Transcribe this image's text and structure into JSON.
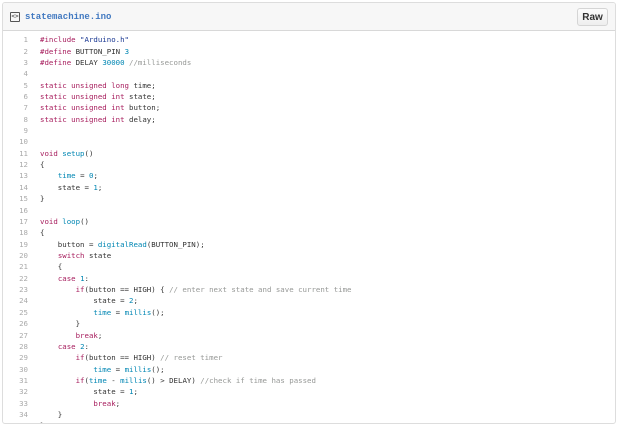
{
  "file": {
    "name": "statemachine.ino",
    "icon": "code-file-icon",
    "raw_label": "Raw"
  },
  "code_lines": [
    [
      [
        "pre",
        "#include "
      ],
      [
        "str",
        "\"Arduino.h\""
      ]
    ],
    [
      [
        "pre",
        "#define "
      ],
      [
        "id",
        "BUTTON_PIN "
      ],
      [
        "nm",
        "3"
      ]
    ],
    [
      [
        "pre",
        "#define "
      ],
      [
        "id",
        "DELAY "
      ],
      [
        "nm",
        "30000"
      ],
      [
        "cm",
        " //milliseconds"
      ]
    ],
    [],
    [
      [
        "kw",
        "static unsigned long "
      ],
      [
        "id",
        "time;"
      ]
    ],
    [
      [
        "kw",
        "static unsigned int "
      ],
      [
        "id",
        "state;"
      ]
    ],
    [
      [
        "kw",
        "static unsigned int "
      ],
      [
        "id",
        "button;"
      ]
    ],
    [
      [
        "kw",
        "static unsigned int "
      ],
      [
        "id",
        "delay;"
      ]
    ],
    [],
    [],
    [
      [
        "kw",
        "void "
      ],
      [
        "nm",
        "setup"
      ],
      [
        "id",
        "()"
      ]
    ],
    [
      [
        "id",
        "{"
      ]
    ],
    [
      [
        "id",
        "    "
      ],
      [
        "nm",
        "time"
      ],
      [
        "id",
        " = "
      ],
      [
        "nm",
        "0"
      ],
      [
        "id",
        ";"
      ]
    ],
    [
      [
        "id",
        "    state = "
      ],
      [
        "nm",
        "1"
      ],
      [
        "id",
        ";"
      ]
    ],
    [
      [
        "id",
        "}"
      ]
    ],
    [],
    [
      [
        "kw",
        "void "
      ],
      [
        "nm",
        "loop"
      ],
      [
        "id",
        "()"
      ]
    ],
    [
      [
        "id",
        "{"
      ]
    ],
    [
      [
        "id",
        "    button = "
      ],
      [
        "nm",
        "digitalRead"
      ],
      [
        "id",
        "(BUTTON_PIN);"
      ]
    ],
    [
      [
        "id",
        "    "
      ],
      [
        "kw",
        "switch"
      ],
      [
        "id",
        " state"
      ]
    ],
    [
      [
        "id",
        "    {"
      ]
    ],
    [
      [
        "id",
        "    "
      ],
      [
        "kw",
        "case "
      ],
      [
        "nm",
        "1"
      ],
      [
        "id",
        ":"
      ]
    ],
    [
      [
        "id",
        "        "
      ],
      [
        "kw",
        "if"
      ],
      [
        "id",
        "(button == HIGH) { "
      ],
      [
        "cm",
        "// enter next state and save current time"
      ]
    ],
    [
      [
        "id",
        "            state = "
      ],
      [
        "nm",
        "2"
      ],
      [
        "id",
        ";"
      ]
    ],
    [
      [
        "id",
        "            "
      ],
      [
        "nm",
        "time"
      ],
      [
        "id",
        " = "
      ],
      [
        "nm",
        "millis"
      ],
      [
        "id",
        "();"
      ]
    ],
    [
      [
        "id",
        "        }"
      ]
    ],
    [
      [
        "id",
        "        "
      ],
      [
        "kw",
        "break"
      ],
      [
        "id",
        ";"
      ]
    ],
    [
      [
        "id",
        "    "
      ],
      [
        "kw",
        "case "
      ],
      [
        "nm",
        "2"
      ],
      [
        "id",
        ":"
      ]
    ],
    [
      [
        "id",
        "        "
      ],
      [
        "kw",
        "if"
      ],
      [
        "id",
        "(button == HIGH) "
      ],
      [
        "cm",
        "// reset timer"
      ]
    ],
    [
      [
        "id",
        "            "
      ],
      [
        "nm",
        "time"
      ],
      [
        "id",
        " = "
      ],
      [
        "nm",
        "millis"
      ],
      [
        "id",
        "();"
      ]
    ],
    [
      [
        "id",
        "        "
      ],
      [
        "kw",
        "if"
      ],
      [
        "id",
        "("
      ],
      [
        "nm",
        "time"
      ],
      [
        "id",
        " - "
      ],
      [
        "nm",
        "millis"
      ],
      [
        "id",
        "() > DELAY) "
      ],
      [
        "cm",
        "//check if time has passed"
      ]
    ],
    [
      [
        "id",
        "            state = "
      ],
      [
        "nm",
        "1"
      ],
      [
        "id",
        ";"
      ]
    ],
    [
      [
        "id",
        "            "
      ],
      [
        "kw",
        "break"
      ],
      [
        "id",
        ";"
      ]
    ],
    [
      [
        "id",
        "    }"
      ]
    ],
    [
      [
        "id",
        "}"
      ]
    ]
  ],
  "colors": {
    "preprocessor": "#a71d5d",
    "keyword": "#a71d5d",
    "string": "#183691",
    "number_or_call": "#0086b3",
    "comment": "#969896",
    "text": "#333333",
    "line_number": "#aaaaaa",
    "file_link": "#4078c0"
  }
}
